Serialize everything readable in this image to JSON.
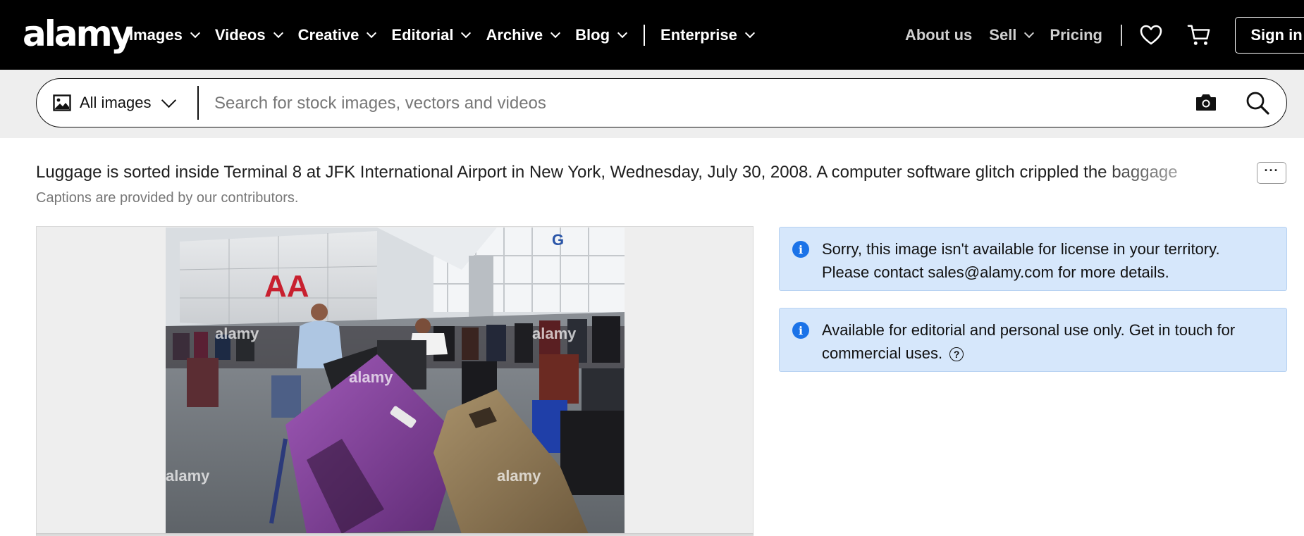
{
  "brand": {
    "logo": "alamy"
  },
  "nav": {
    "items": [
      {
        "label": "Images"
      },
      {
        "label": "Videos"
      },
      {
        "label": "Creative"
      },
      {
        "label": "Editorial"
      },
      {
        "label": "Archive"
      },
      {
        "label": "Blog"
      },
      {
        "label": "Enterprise"
      }
    ],
    "right": {
      "about": "About us",
      "sell": "Sell",
      "pricing": "Pricing",
      "favorites_icon": "heart-icon",
      "cart_icon": "cart-icon",
      "signin": "Sign in"
    }
  },
  "search": {
    "filter_label": "All images",
    "filter_icon": "image-icon",
    "placeholder": "Search for stock images, vectors and videos",
    "value": "",
    "camera_icon": "camera-icon",
    "search_icon": "search-icon"
  },
  "caption": {
    "text": "Luggage is sorted inside Terminal 8 at JFK International Airport in New York, Wednesday, July 30, 2008. A computer software glitch crippled the baggage",
    "more_label": "···",
    "note": "Captions are provided by our contributors."
  },
  "photo": {
    "watermark": "alamy",
    "logo_text": "AA",
    "sign_letter": "G"
  },
  "notices": [
    {
      "lines": [
        "Sorry, this image isn't available for license in your territory.",
        "Please contact sales@alamy.com for more details."
      ]
    },
    {
      "lines": [
        "Available for editorial and personal use only. Get in touch for",
        "commercial uses."
      ],
      "help_icon": "question-circle-icon"
    }
  ],
  "colors": {
    "nav_bg": "#000000",
    "search_band": "#eeeeee",
    "notice_bg": "#d6e7fb",
    "info_blue": "#1b73e8"
  }
}
